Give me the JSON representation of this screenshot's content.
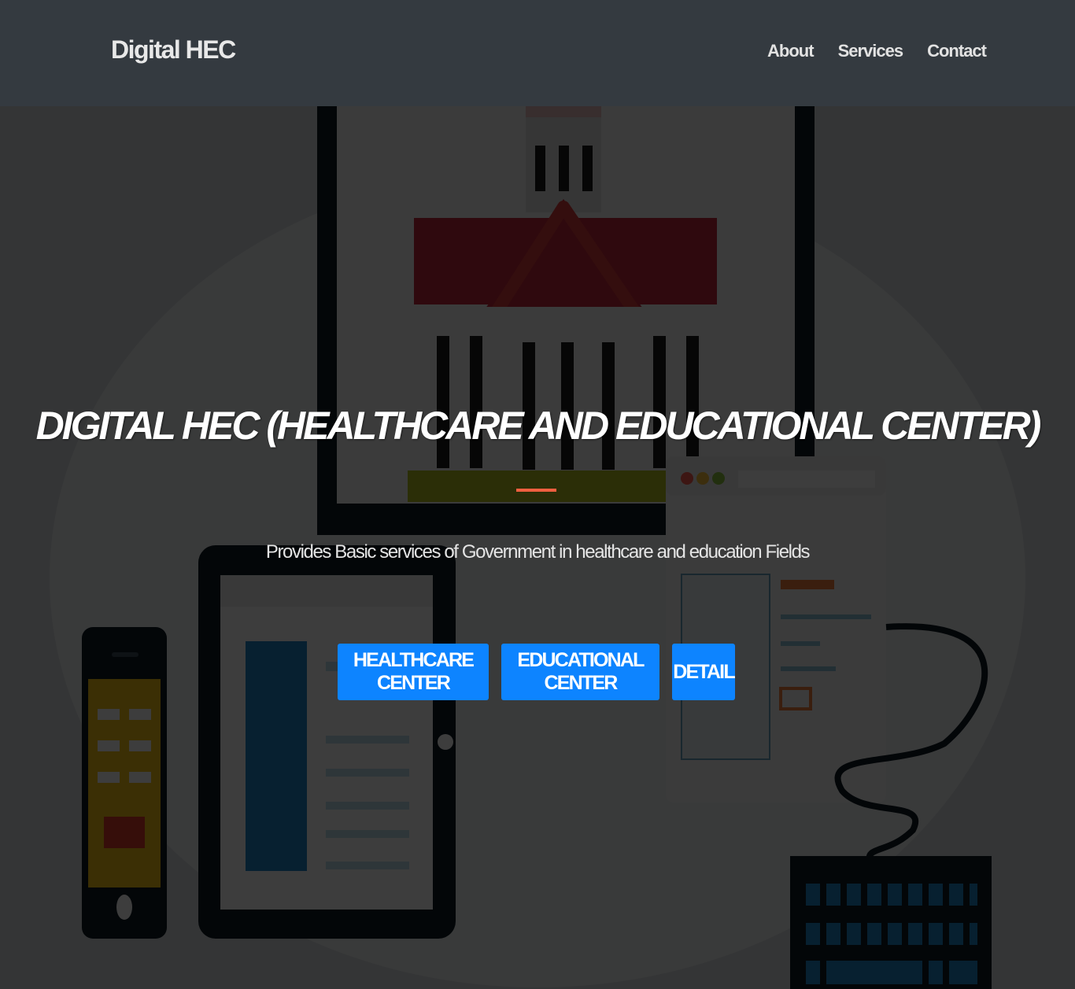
{
  "navbar": {
    "brand": "Digital HEC",
    "links": [
      "About",
      "Services",
      "Contact"
    ]
  },
  "hero": {
    "title": "Digital HEC (Healthcare and Educational Center)",
    "subtitle": "Provides Basic services of Government in healthcare and education Fields",
    "buttons": [
      "Healthcare Center",
      "Educational Center",
      "Detail"
    ],
    "accent_color": "#f05f40",
    "button_color": "#0d84ff",
    "background_illustration": "illustration-building-devices"
  }
}
